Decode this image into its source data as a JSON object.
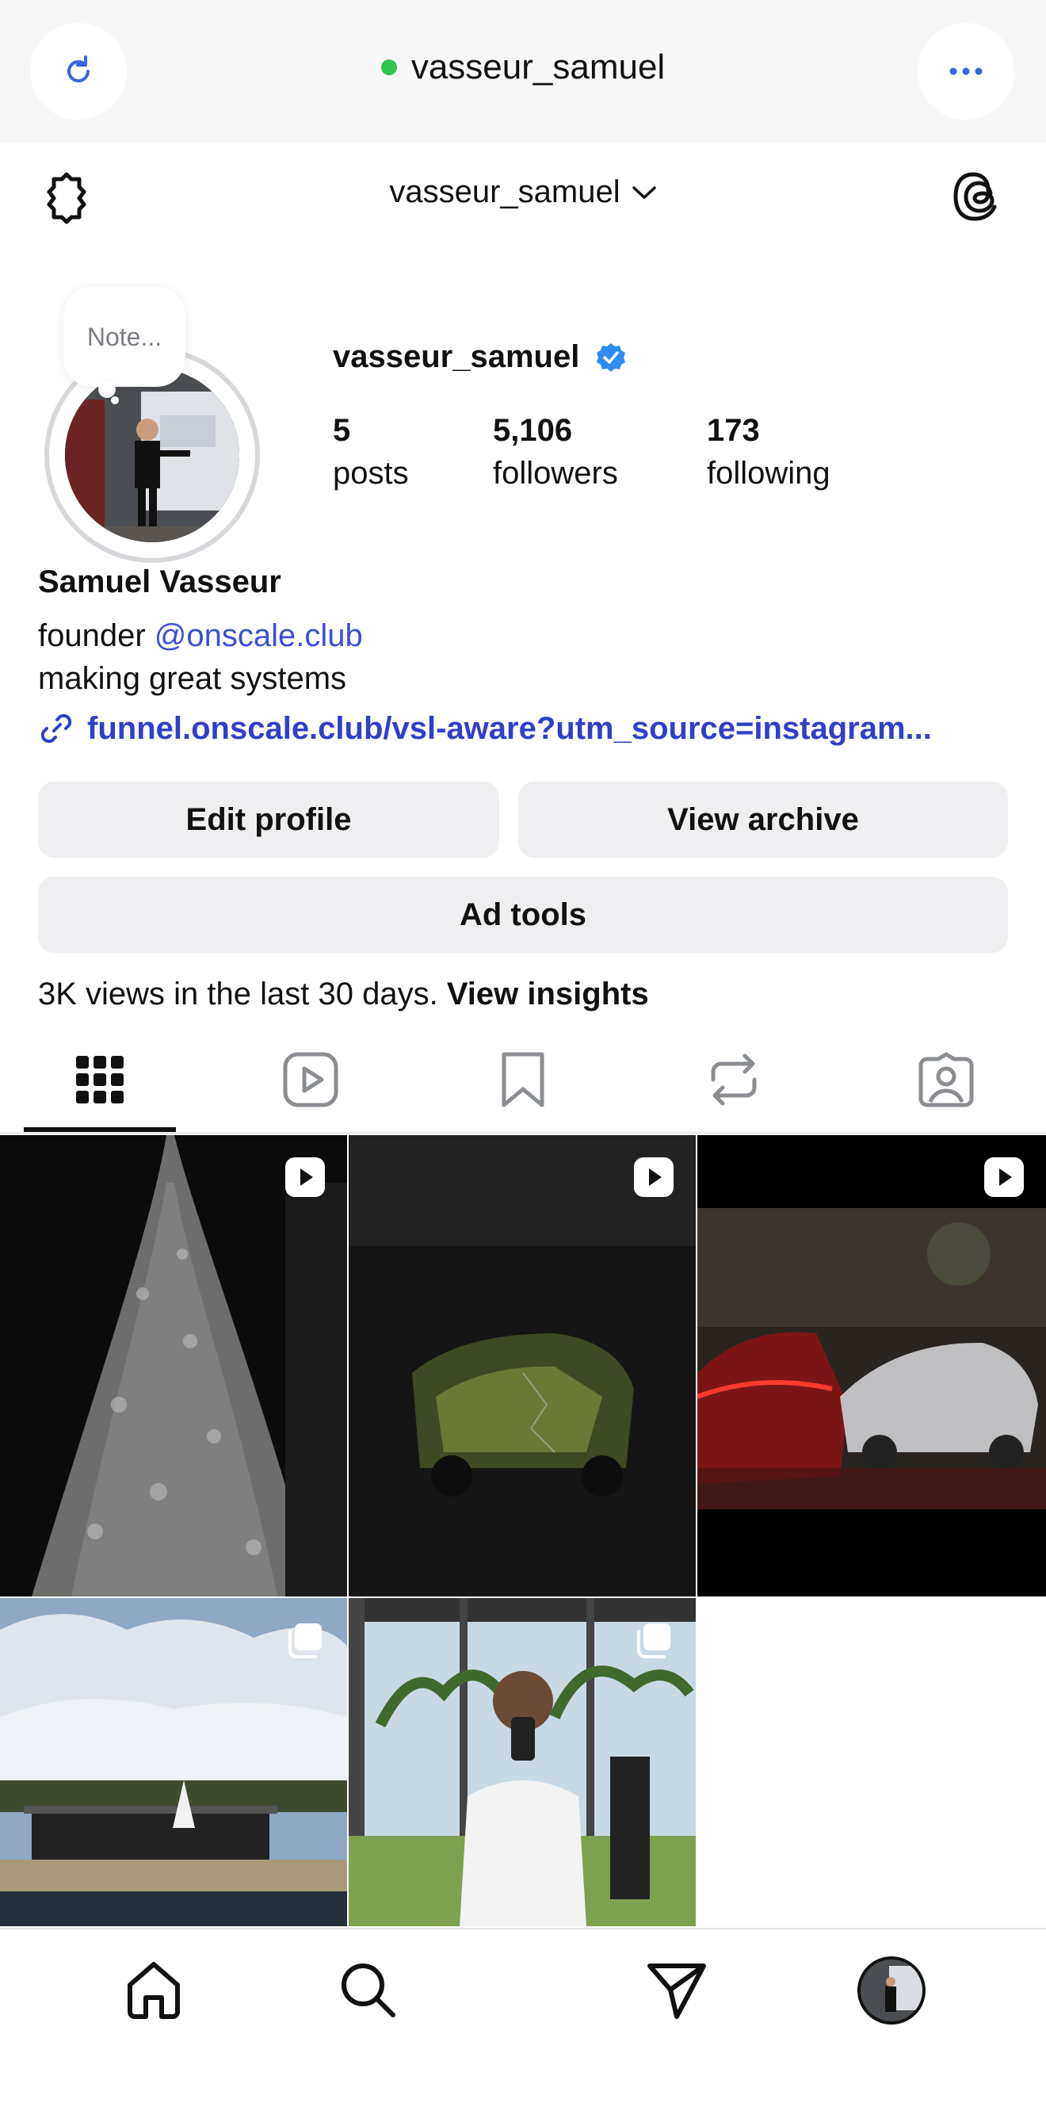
{
  "browser": {
    "title": "vasseur_samuel",
    "status_color": "#2dc653"
  },
  "header": {
    "username": "vasseur_samuel"
  },
  "profile": {
    "note_placeholder": "Note...",
    "username": "vasseur_samuel",
    "verified": true,
    "stats": [
      {
        "value": "5",
        "label": "posts"
      },
      {
        "value": "5,106",
        "label": "followers"
      },
      {
        "value": "173",
        "label": "following"
      }
    ],
    "full_name": "Samuel Vasseur",
    "bio_prefix": "founder ",
    "bio_mention": "@onscale.club",
    "bio_line2": "making great systems",
    "link": "funnel.onscale.club/vsl-aware?utm_source=instagram...",
    "accent_color": "#2f3fc8"
  },
  "buttons": {
    "edit_profile": "Edit profile",
    "view_archive": "View archive",
    "ad_tools": "Ad tools"
  },
  "insights": {
    "text": "3K views in the last 30 days. ",
    "link": "View insights"
  },
  "tabs": [
    {
      "icon": "grid-icon",
      "active": true
    },
    {
      "icon": "reels-icon",
      "active": false
    },
    {
      "icon": "saved-icon",
      "active": false
    },
    {
      "icon": "reposts-icon",
      "active": false
    },
    {
      "icon": "tagged-icon",
      "active": false
    }
  ],
  "posts": [
    {
      "subject": "christmas tree",
      "badge": "reel-icon"
    },
    {
      "subject": "car in dark garage",
      "badge": "reel-icon"
    },
    {
      "subject": "cars at night",
      "badge": "reel-icon"
    },
    {
      "subject": "villa and sky",
      "badge": "carousel-icon"
    },
    {
      "subject": "mirror selfie at gym",
      "badge": "carousel-icon"
    }
  ],
  "bottom_nav": [
    {
      "icon": "home-icon"
    },
    {
      "icon": "search-icon"
    },
    {
      "icon": "direct-messages-icon"
    },
    {
      "icon": "profile-avatar"
    }
  ]
}
